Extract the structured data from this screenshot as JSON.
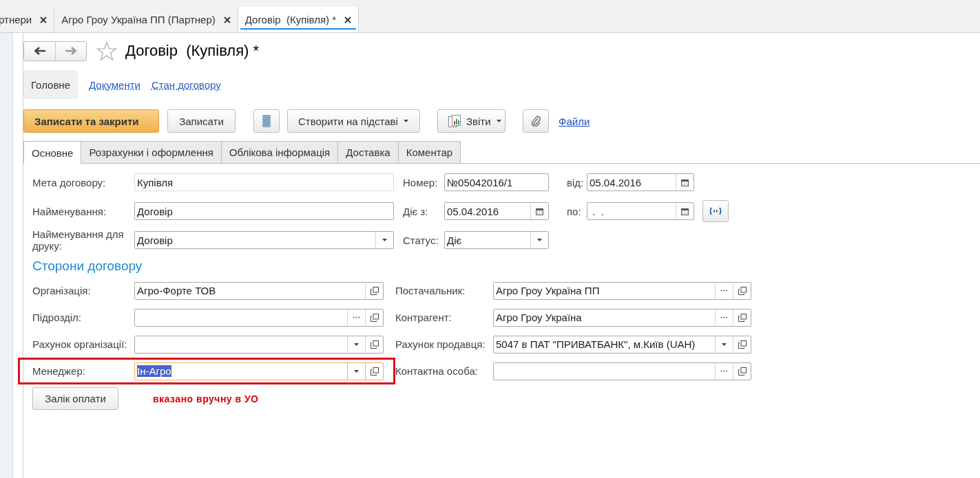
{
  "doc_tabs": [
    {
      "label": "ртнери",
      "selected": false
    },
    {
      "label": "Агро Гроу Україна ПП (Партнер)",
      "selected": false
    },
    {
      "label": "Договір  (Купівля) *",
      "selected": true
    }
  ],
  "title": "Договір  (Купівля) *",
  "favorite": false,
  "sections": [
    {
      "label": "Головне",
      "selected": true
    },
    {
      "label": "Документи",
      "selected": false
    },
    {
      "label": "Стан договору",
      "selected": false
    }
  ],
  "toolbar": [
    {
      "kind": "primary",
      "label": "Записати та закрити"
    },
    {
      "kind": "button",
      "label": "Записати"
    },
    {
      "kind": "list"
    },
    {
      "kind": "dropdown",
      "label": "Створити на підставі"
    },
    {
      "kind": "report",
      "label": "Звіти"
    },
    {
      "kind": "clip"
    },
    {
      "kind": "link",
      "label": "Файли"
    }
  ],
  "form_tabs": [
    {
      "label": "Основне",
      "selected": true
    },
    {
      "label": "Розрахунки і оформлення",
      "selected": false
    },
    {
      "label": "Облікова інформація",
      "selected": false
    },
    {
      "label": "Доставка",
      "selected": false
    },
    {
      "label": "Коментар",
      "selected": false
    }
  ],
  "header_rows": [
    {
      "left": {
        "label": "Мета договору:",
        "value": "Купівля",
        "kind": "text",
        "readonly": true
      },
      "right": [
        {
          "label": "Номер:",
          "value": "№05042016/1",
          "kind": "text"
        },
        {
          "label": "від:",
          "value": "05.04.2016",
          "kind": "date"
        }
      ]
    },
    {
      "left": {
        "label": "Найменування:",
        "value": "Договір",
        "kind": "text",
        "readonly": false
      },
      "right": [
        {
          "label": "Діє з:",
          "value": "05.04.2016",
          "kind": "date"
        },
        {
          "label": "по:",
          "value": " .  .",
          "kind": "date"
        }
      ],
      "period_button": true
    },
    {
      "left": {
        "label": "Найменування для друку:",
        "value": "Договір",
        "kind": "select",
        "readonly": false
      },
      "right": [
        {
          "label": "Статус:",
          "value": "Діє",
          "kind": "select"
        }
      ]
    }
  ],
  "parties_heading": "Сторони договору",
  "parties": [
    {
      "left": {
        "label": "Організація:",
        "value": "Агро-Форте ТОВ",
        "kind": "ref"
      },
      "right": {
        "label": "Постачальник:",
        "value": "Агро Гроу Україна ПП",
        "kind": "choice_ref"
      }
    },
    {
      "left": {
        "label": "Підрозділ:",
        "kind": "choice_ref"
      },
      "right": {
        "label": "Контрагент:",
        "value": "Агро Гроу Україна",
        "kind": "choice_ref"
      }
    },
    {
      "left": {
        "label": "Рахунок організації:",
        "kind": "select_ref"
      },
      "right": {
        "label": "Рахунок продавця:",
        "value": "5047 в ПАТ \"ПРИВАТБАНК\", м.Київ (UAH)",
        "kind": "select_ref"
      }
    },
    {
      "left": {
        "label": "Менеджер:",
        "value": "Ін-Агро",
        "kind": "select_ref",
        "focused": true
      },
      "right": {
        "label": "Контактна особа:",
        "kind": "choice_ref"
      },
      "highlighted": true
    }
  ],
  "offset_button": "Залік оплати",
  "annotation": "вказано вручну в УО"
}
